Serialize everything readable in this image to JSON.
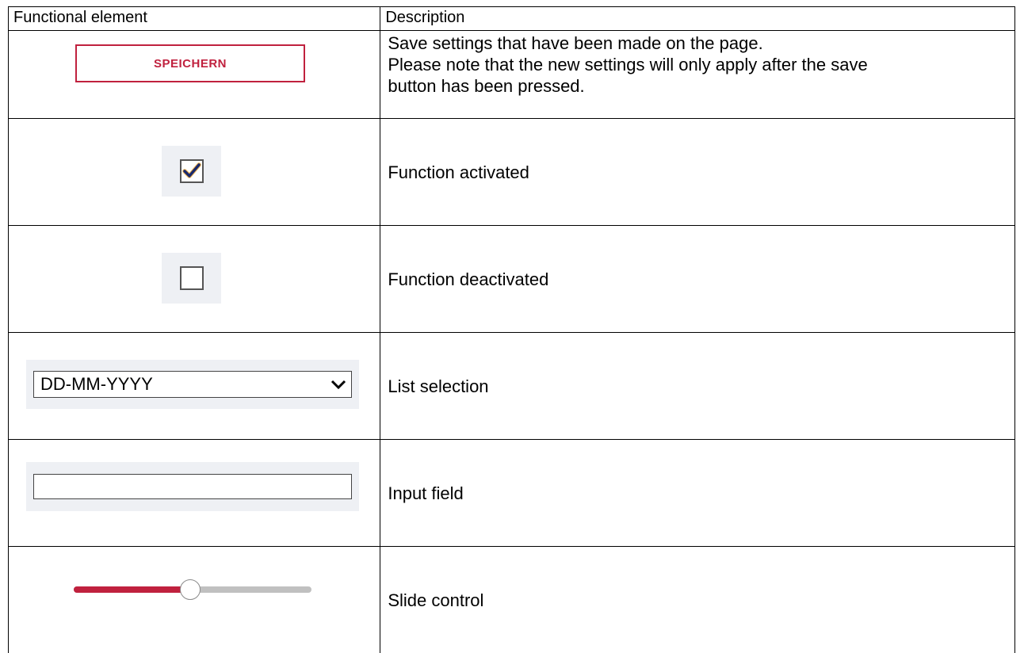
{
  "table": {
    "headers": [
      "Functional element",
      "Description"
    ],
    "rows": [
      {
        "element": "save-button",
        "button_label": "SPEICHERN",
        "description": [
          "Save settings that have been made on the page.",
          "Please note that the new settings will only apply after the save",
          "button has been pressed."
        ]
      },
      {
        "element": "checkbox-checked",
        "checked": true,
        "description": "Function activated"
      },
      {
        "element": "checkbox-unchecked",
        "checked": false,
        "description": "Function deactivated"
      },
      {
        "element": "list-selection",
        "selected_value": "DD-MM-YYYY",
        "icon": "chevron-down-icon",
        "description": "List selection"
      },
      {
        "element": "input-field",
        "value": "",
        "description": "Input field"
      },
      {
        "element": "slide-control",
        "level": 0.49,
        "description": "Slide control"
      }
    ]
  },
  "colors": {
    "accent": "#c0213e",
    "check": "#1a2a6c",
    "control_bg": "#eef0f4"
  }
}
